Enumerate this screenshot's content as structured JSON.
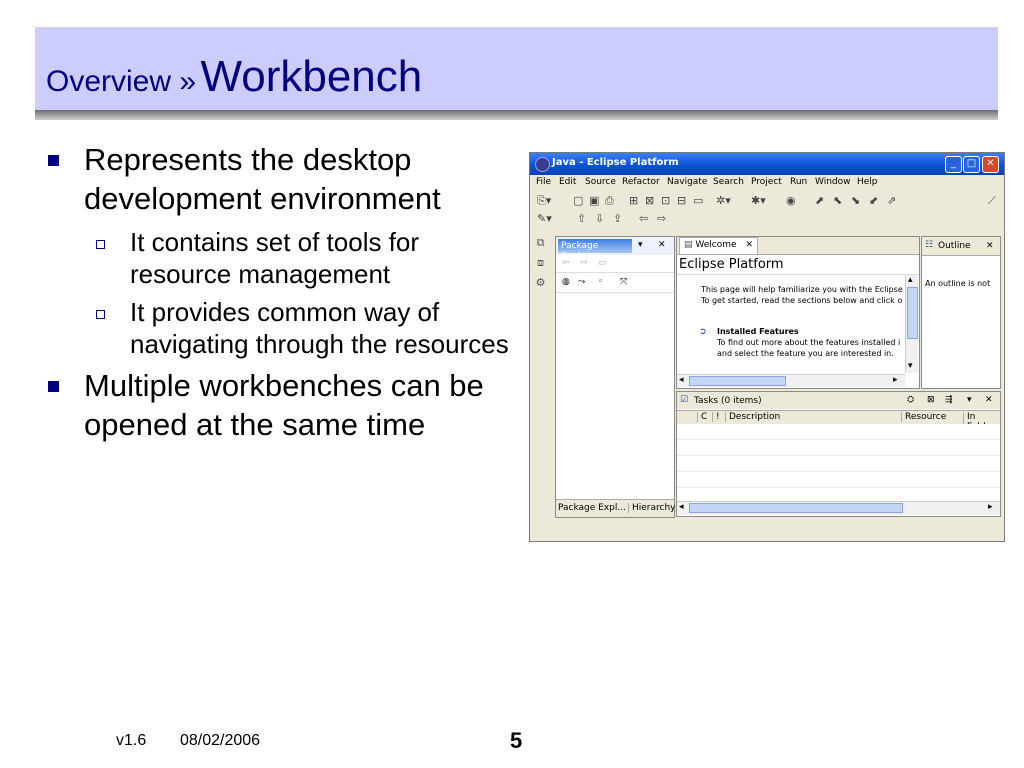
{
  "slide": {
    "title_prefix": "Overview »",
    "title_main": "Workbench",
    "bullets": [
      {
        "text": "Represents the desktop development environment",
        "sub": [
          "It contains set of tools for resource management",
          "It provides common way of navigating through the resources"
        ]
      },
      {
        "text": "Multiple workbenches can be opened at the same time",
        "sub": []
      }
    ],
    "footer": {
      "version": "v1.6",
      "date": "08/02/2006",
      "page": "5"
    }
  },
  "eclipse": {
    "window_title": "Java - Eclipse Platform",
    "menus": [
      "File",
      "Edit",
      "Source",
      "Refactor",
      "Navigate",
      "Search",
      "Project",
      "Run",
      "Window",
      "Help"
    ],
    "package_explorer_tab": "Package Explorer",
    "welcome_tab": "Welcome",
    "welcome_heading": "Eclipse Platform",
    "welcome_text1": "This page will help familiarize you with the Eclipse w",
    "welcome_text2": "To get started, read the sections below and click o",
    "installed_heading": "Installed Features",
    "installed_text1": "To find out more about the features installed i",
    "installed_text2": "and select the feature you are interested in.",
    "outline_tab": "Outline",
    "outline_text": "An outline is not",
    "tasks_tab": "Tasks (0 items)",
    "tasks_columns": [
      "C",
      "!",
      "Description",
      "Resource",
      "In Folde"
    ],
    "bottom_tabs": [
      "Package Expl...",
      "Hierarchy"
    ]
  }
}
